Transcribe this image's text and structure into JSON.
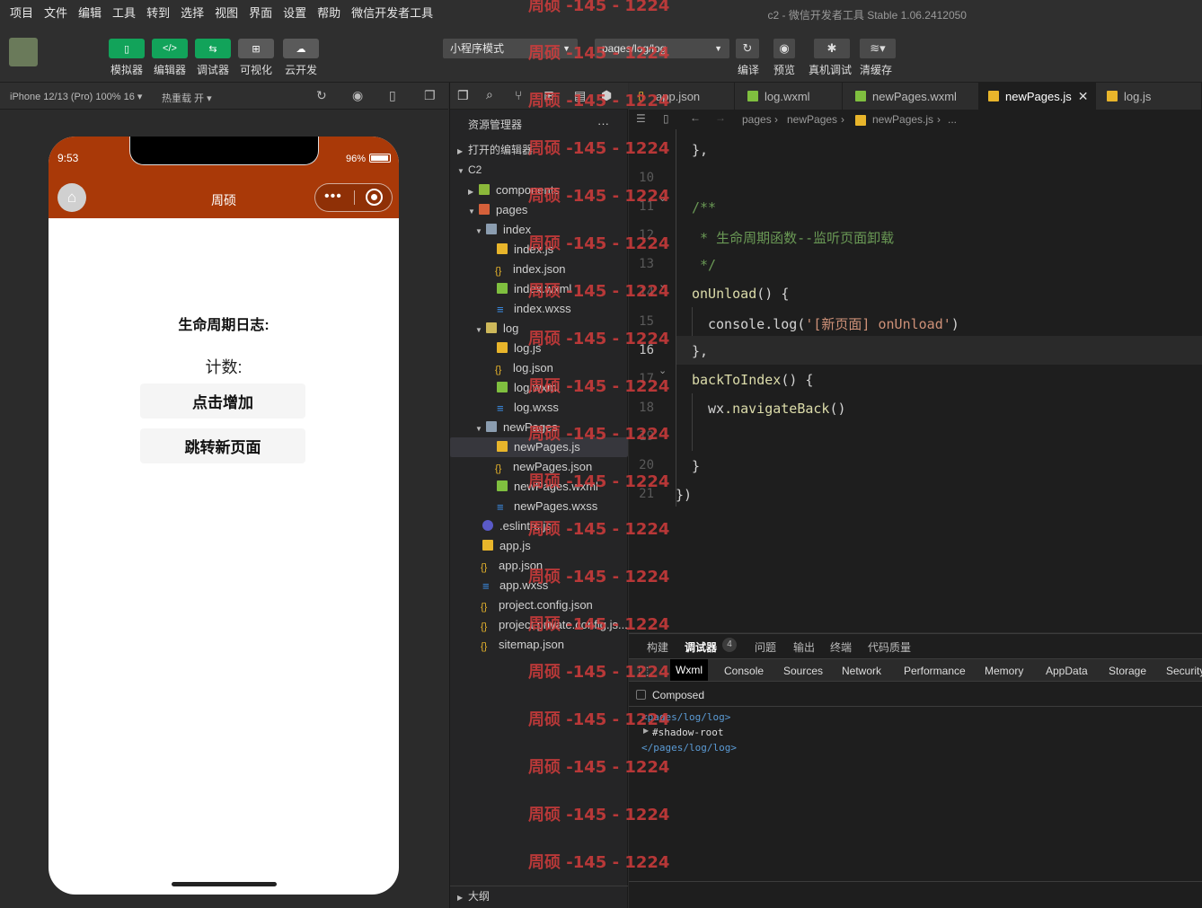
{
  "menu": [
    "项目",
    "文件",
    "编辑",
    "工具",
    "转到",
    "选择",
    "视图",
    "界面",
    "设置",
    "帮助",
    "微信开发者工具"
  ],
  "window_title": "c2 - 微信开发者工具 Stable 1.06.2412050",
  "toolbar": {
    "left": [
      "模拟器",
      "编辑器",
      "调试器",
      "可视化",
      "云开发"
    ],
    "mode": "小程序模式",
    "page": "pages/log/log",
    "right": [
      "编译",
      "预览",
      "真机调试",
      "清缓存"
    ]
  },
  "sim": {
    "device": "iPhone 12/13 (Pro) 100% 16",
    "hot": "热重载 开"
  },
  "phone": {
    "time": "9:53",
    "battery": "96%",
    "title": "周硕",
    "log_title": "生命周期日志:",
    "count": "计数:",
    "btn1": "点击增加",
    "btn2": "跳转新页面"
  },
  "explorer": {
    "title": "资源管理器",
    "open": "打开的编辑器",
    "root": "C2",
    "outline": "大纲",
    "files": [
      "components",
      "pages",
      "index",
      "index.js",
      "index.json",
      "index.wxml",
      "index.wxss",
      "log",
      "log.js",
      "log.json",
      "log.wxml",
      "log.wxss",
      "newPages",
      "newPages.js",
      "newPages.json",
      "newPages.wxml",
      "newPages.wxss",
      ".eslintrc.js",
      "app.js",
      "app.json",
      "app.wxss",
      "project.config.json",
      "project.private.config.js...",
      "sitemap.json"
    ]
  },
  "tabs": [
    "app.json",
    "log.wxml",
    "newPages.wxml",
    "newPages.js",
    "log.js"
  ],
  "breadcrumb": [
    "pages",
    "newPages",
    "newPages.js",
    "..."
  ],
  "lines": [
    "10",
    "11",
    "12",
    "13",
    "14",
    "15",
    "16",
    "17",
    "18",
    "19",
    "20",
    "21"
  ],
  "code": {
    "l0": "},",
    "l11": "/**",
    "l12": " * 生命周期函数--监听页面卸载",
    "l13": " */",
    "l14a": "onUnload",
    "l14b": "() {",
    "l15a": "console",
    "l15b": ".log(",
    "l15c": "'[新页面] onUnload'",
    "l15d": ")",
    "l16": "},",
    "l17a": "backToIndex",
    "l17b": "() {",
    "l18a": "wx",
    "l18b": ".navigateBack",
    "l18c": "()",
    "l20": "}",
    "l21": "})"
  },
  "devtools": {
    "tabs": [
      "构建",
      "调试器",
      "问题",
      "输出",
      "终端",
      "代码质量"
    ],
    "badge": "4",
    "panels": [
      "Wxml",
      "Console",
      "Sources",
      "Network",
      "Performance",
      "Memory",
      "AppData",
      "Storage",
      "Security"
    ],
    "composed": "Composed",
    "xml1": "<pages/log/log>",
    "xml2": "#shadow-root",
    "xml3": "</pages/log/log>"
  },
  "watermark": "周硕 -145 - 1224"
}
